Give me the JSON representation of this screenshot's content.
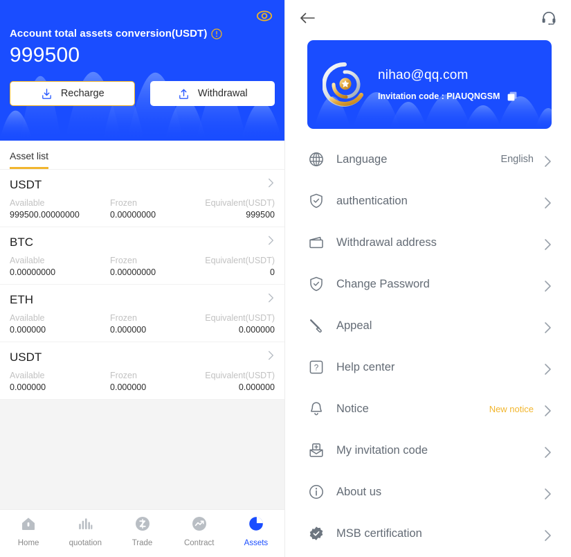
{
  "left": {
    "hero": {
      "eye_icon": "eye-icon",
      "title": "Account total assets conversion(USDT)",
      "info_icon": "info-circle-icon",
      "amount": "999500",
      "recharge_label": "Recharge",
      "recharge_icon": "download-box-icon",
      "withdrawal_label": "Withdrawal",
      "withdrawal_icon": "upload-box-icon",
      "bg_color": "#1a4dff",
      "accent_color": "#f0b323"
    },
    "tab_label": "Asset list",
    "columns": [
      "Available",
      "Frozen",
      "Equivalent(USDT)"
    ],
    "assets": [
      {
        "symbol": "USDT",
        "available": "999500.00000000",
        "frozen": "0.00000000",
        "equivalent": "999500"
      },
      {
        "symbol": "BTC",
        "available": "0.00000000",
        "frozen": "0.00000000",
        "equivalent": "0"
      },
      {
        "symbol": "ETH",
        "available": "0.000000",
        "frozen": "0.000000",
        "equivalent": "0.000000"
      },
      {
        "symbol": "USDT",
        "available": "0.000000",
        "frozen": "0.000000",
        "equivalent": "0.000000"
      }
    ],
    "tabbar": [
      {
        "label": "Home",
        "icon": "home-icon",
        "active": false
      },
      {
        "label": "quotation",
        "icon": "bars-icon",
        "active": false
      },
      {
        "label": "Trade",
        "icon": "trade-icon",
        "active": false
      },
      {
        "label": "Contract",
        "icon": "contract-icon",
        "active": false
      },
      {
        "label": "Assets",
        "icon": "pie-icon",
        "active": true
      }
    ]
  },
  "right": {
    "header": {
      "back_icon": "arrow-left-icon",
      "support_icon": "headset-icon"
    },
    "profile": {
      "logo_icon": "spiral-star-logo-icon",
      "email": "nihao@qq.com",
      "invitation_text": "Invitation code : PIAUQNGSM",
      "copy_icon": "copy-icon",
      "bg_color": "#1a4dff"
    },
    "menu": [
      {
        "label": "Language",
        "icon": "globe-icon",
        "value": "English",
        "warn": false
      },
      {
        "label": "authentication",
        "icon": "shield-check-icon",
        "value": "",
        "warn": false
      },
      {
        "label": "Withdrawal address",
        "icon": "wallet-icon",
        "value": "",
        "warn": false
      },
      {
        "label": "Change Password",
        "icon": "shield-check-icon",
        "value": "",
        "warn": false
      },
      {
        "label": "Appeal",
        "icon": "pen-icon",
        "value": "",
        "warn": false
      },
      {
        "label": "Help center",
        "icon": "question-box-icon",
        "value": "",
        "warn": false
      },
      {
        "label": "Notice",
        "icon": "bell-icon",
        "value": "New notice",
        "warn": true
      },
      {
        "label": "My invitation code",
        "icon": "envelope-plus-icon",
        "value": "",
        "warn": false
      },
      {
        "label": "About us",
        "icon": "info-circle-icon",
        "value": "",
        "warn": false
      },
      {
        "label": "MSB certification",
        "icon": "badge-check-icon",
        "value": "",
        "warn": false
      }
    ]
  }
}
